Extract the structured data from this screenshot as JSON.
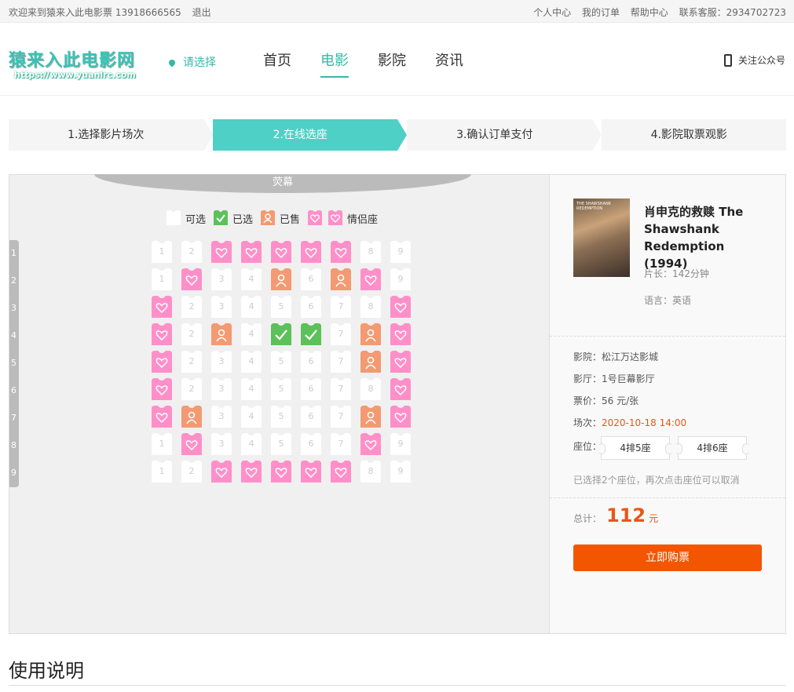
{
  "topbar": {
    "welcome": "欢迎来到猿来入此电影票 13918666565",
    "logout": "退出",
    "links": [
      "个人中心",
      "我的订单",
      "帮助中心",
      "联系客服：2934702723"
    ]
  },
  "header": {
    "logo_cn": "猿来入此电影网",
    "logo_url": "https://www.yuanlrc.com",
    "city": "请选择",
    "nav": [
      "首页",
      "电影",
      "影院",
      "资讯"
    ],
    "nav_active": 1,
    "follow": "关注公众号"
  },
  "steps": [
    "1.选择影片场次",
    "2.在线选座",
    "3.确认订单支付",
    "4.影院取票观影"
  ],
  "steps_active": 1,
  "hall": {
    "screen_label": "荧幕",
    "legend": {
      "available": "可选",
      "selected": "已选",
      "sold": "已售",
      "couple": "情侣座"
    },
    "row_labels": [
      "1",
      "2",
      "3",
      "4",
      "5",
      "6",
      "7",
      "8",
      "9"
    ],
    "seat_map": [
      [
        "A",
        "A",
        "C",
        "C",
        "C",
        "C",
        "C",
        "A",
        "A"
      ],
      [
        "A",
        "C",
        "A",
        "A",
        "S",
        "A",
        "S",
        "C",
        "A"
      ],
      [
        "C",
        "A",
        "A",
        "A",
        "A",
        "A",
        "A",
        "A",
        "C"
      ],
      [
        "C",
        "A",
        "S",
        "A",
        "X",
        "X",
        "A",
        "S",
        "C"
      ],
      [
        "C",
        "A",
        "A",
        "A",
        "A",
        "A",
        "A",
        "S",
        "C"
      ],
      [
        "C",
        "A",
        "A",
        "A",
        "A",
        "A",
        "A",
        "A",
        "C"
      ],
      [
        "C",
        "S",
        "A",
        "A",
        "A",
        "A",
        "A",
        "S",
        "C"
      ],
      [
        "A",
        "C",
        "A",
        "A",
        "A",
        "A",
        "A",
        "C",
        "A"
      ],
      [
        "A",
        "A",
        "C",
        "C",
        "C",
        "C",
        "C",
        "A",
        "A"
      ]
    ]
  },
  "colors": {
    "accent": "#4fd0c6",
    "couple": "#ff8fc8",
    "sold": "#f39a72",
    "selected": "#5cc15a",
    "available": "#ffffff",
    "buy": "#f25600"
  },
  "movie": {
    "title": "肖申克的救赎 The Shawshank Redemption (1994)",
    "duration": "片长：142分钟",
    "language": "语言：英语",
    "cinema": "影院：松江万达影城",
    "hall": "影厅：1号巨幕影厅",
    "price": "票价：56 元/张",
    "showtime_label": "场次：",
    "showtime": "2020-10-18 14:00",
    "seat_label": "座位：",
    "seats": [
      "4排5座",
      "4排6座"
    ],
    "note": "已选择2个座位，再次点击座位可以取消",
    "total_label": "总计：",
    "total": "112",
    "total_unit": "元",
    "buy_label": "立即购票"
  },
  "usage_title": "使用说明"
}
